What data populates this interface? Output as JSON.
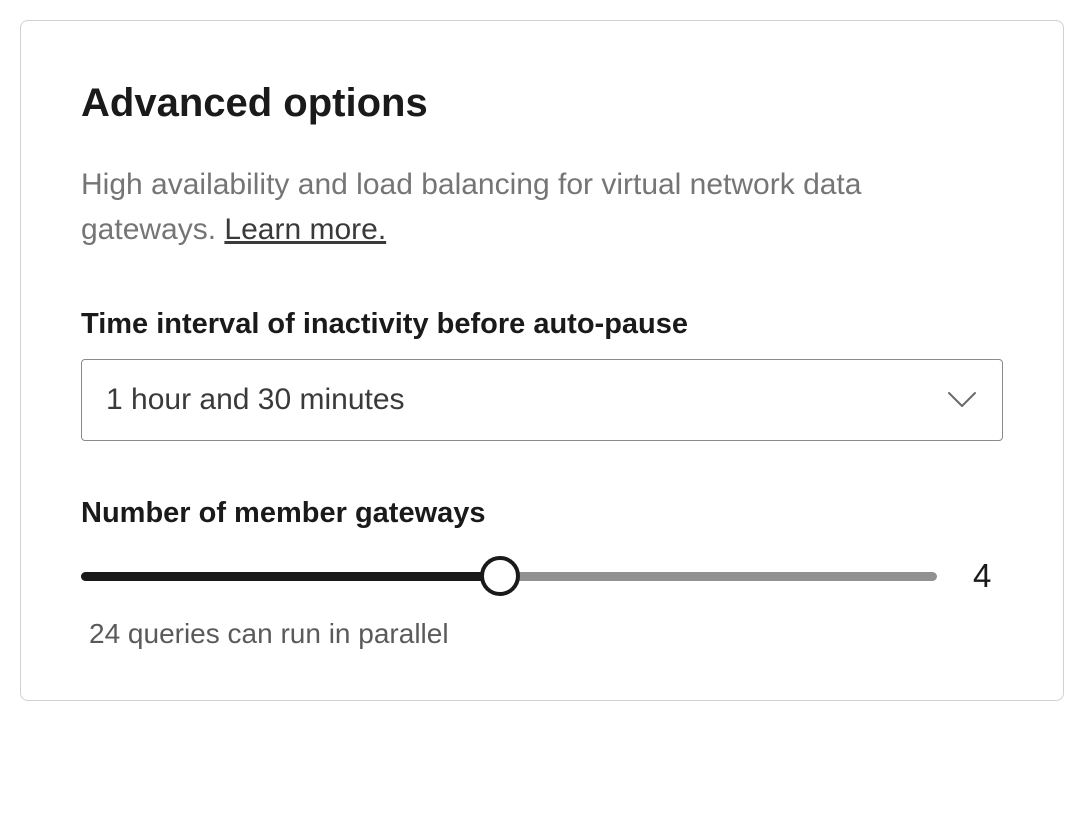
{
  "panel": {
    "heading": "Advanced options",
    "description_prefix": "High availability and load balancing for virtual network data gateways. ",
    "learn_more": "Learn more.",
    "time_interval": {
      "label": "Time interval of inactivity before auto-pause",
      "selected": "1 hour and 30 minutes"
    },
    "member_gateways": {
      "label": "Number of member gateways",
      "value": "4",
      "caption": "24 queries can run in parallel"
    }
  }
}
